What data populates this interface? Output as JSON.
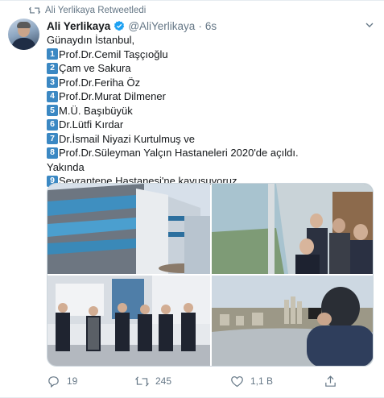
{
  "retweet_banner": {
    "icon": "retweet-icon",
    "text": "Ali Yerlikaya Retweetledi"
  },
  "author": {
    "name": "Ali Yerlikaya",
    "handle": "@AliYerlikaya",
    "separator": "·",
    "time": "6s",
    "verified_icon": "verified-badge-icon"
  },
  "tweet": {
    "greeting": "Günaydın İstanbul,",
    "items": [
      {
        "num": "1",
        "text": "Prof.Dr.Cemil Taşçıoğlu"
      },
      {
        "num": "2",
        "text": "Çam ve Sakura"
      },
      {
        "num": "3",
        "text": "Prof.Dr.Feriha Öz"
      },
      {
        "num": "4",
        "text": "Prof.Dr.Murat Dilmener"
      },
      {
        "num": "5",
        "text": "M.Ü. Başıbüyük"
      },
      {
        "num": "6",
        "text": "Dr.Lütfi Kırdar"
      },
      {
        "num": "7",
        "text": "Dr.İsmail Niyazi Kurtulmuş ve"
      },
      {
        "num": "8",
        "text": "Prof.Dr.Süleyman Yalçın Hastaneleri 2020'de açıldı."
      }
    ],
    "middle": "Yakında",
    "last_item": {
      "num": "9",
      "text": "Seyrantepe Hastanesi'ne kavuşuyoruz."
    },
    "emoji": "👏👏👏"
  },
  "media": [
    {
      "name": "hospital-building-photo"
    },
    {
      "name": "officials-window-view-photo"
    },
    {
      "name": "officials-group-photo"
    },
    {
      "name": "city-view-photo"
    }
  ],
  "actions": {
    "reply": {
      "icon": "reply-icon",
      "count": "19"
    },
    "retweet": {
      "icon": "retweet-icon",
      "count": "245"
    },
    "like": {
      "icon": "heart-icon",
      "count": "1,1 B"
    },
    "share": {
      "icon": "share-icon"
    }
  },
  "colors": {
    "accent": "#1da1f2",
    "keycap": "#3b88c3",
    "muted": "#657786",
    "text": "#14171a"
  }
}
